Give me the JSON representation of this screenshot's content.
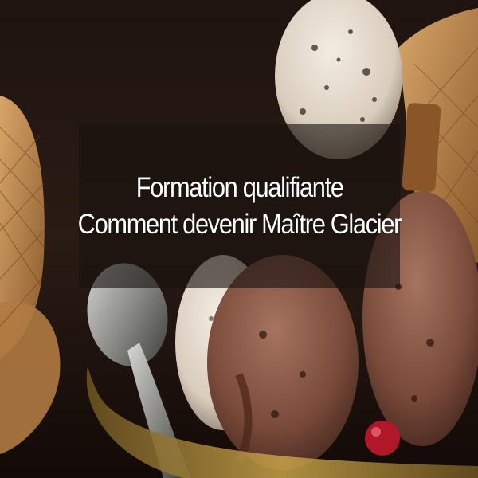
{
  "banner": {
    "line1": "Formation qualifiante",
    "line2": "Comment devenir Maître Glacier"
  }
}
